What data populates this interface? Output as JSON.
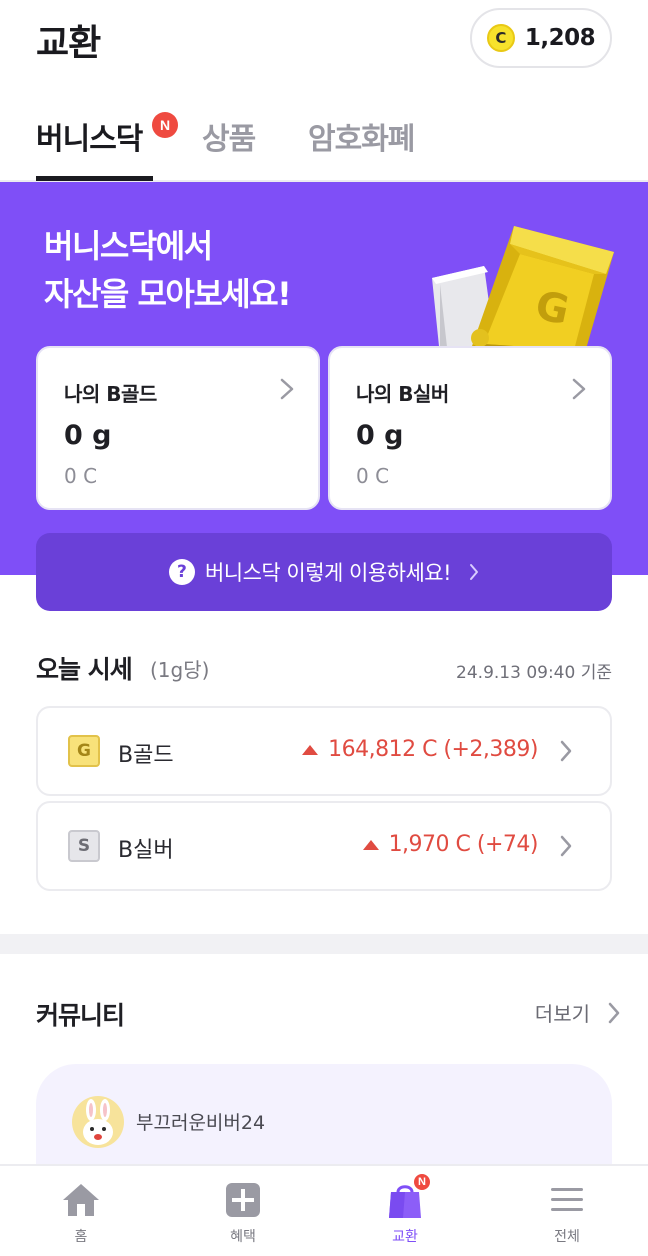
{
  "header": {
    "title": "교환",
    "coin_balance": "1,208",
    "coin_symbol": "C"
  },
  "tabs": [
    {
      "label": "버니스닥",
      "active": true,
      "badge": "N"
    },
    {
      "label": "상품",
      "active": false
    },
    {
      "label": "암호화폐",
      "active": false
    }
  ],
  "hero": {
    "title_line1": "버니스닥에서",
    "title_line2": "자산을 모아보세요!",
    "bar_letter": "G",
    "background_color": "#7f4ff7"
  },
  "assets": [
    {
      "label": "나의 B골드",
      "grams": "0 g",
      "coins": "0 C"
    },
    {
      "label": "나의 B실버",
      "grams": "0 g",
      "coins": "0 C"
    }
  ],
  "guide": {
    "icon": "question-icon",
    "label": "버니스닥 이렇게 이용하세요!"
  },
  "rates": {
    "title": "오늘 시세",
    "unit": "(1g당)",
    "timestamp": "24.9.13 09:40 기준",
    "items": [
      {
        "icon_letter": "G",
        "name": "B골드",
        "price": "164,812 C (+2,389)"
      },
      {
        "icon_letter": "S",
        "name": "B실버",
        "price": "1,970 C (+74)"
      }
    ],
    "up_color": "#e04b41"
  },
  "community": {
    "title": "커뮤니티",
    "more": "더보기",
    "post": {
      "username": "부끄러운비버24"
    }
  },
  "bottom_nav": [
    {
      "label": "홈",
      "icon": "home-icon",
      "active": false
    },
    {
      "label": "혜택",
      "icon": "plus-box-icon",
      "active": false
    },
    {
      "label": "교환",
      "icon": "shopping-bag-icon",
      "active": true,
      "badge": "N"
    },
    {
      "label": "전체",
      "icon": "menu-icon",
      "active": false
    }
  ]
}
